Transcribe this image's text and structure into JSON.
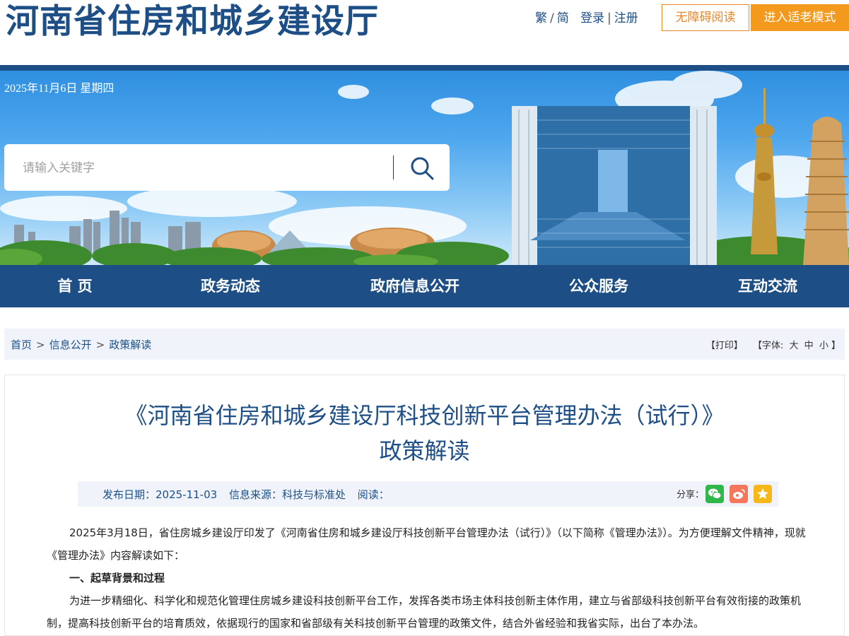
{
  "header": {
    "site_title": "河南省住房和城乡建设厅",
    "lang_trad": "繁",
    "lang_sep": "/",
    "lang_simp": "简",
    "login": "登录",
    "pipe": "|",
    "register": "注册",
    "accessible_btn": "无障碍阅读",
    "elder_btn": "进入适老模式"
  },
  "banner": {
    "date": "2025年11月6日 星期四",
    "search_placeholder": "请输入关键字"
  },
  "nav": {
    "items": [
      {
        "label": "首 页"
      },
      {
        "label": "政务动态"
      },
      {
        "label": "政府信息公开"
      },
      {
        "label": "公众服务"
      },
      {
        "label": "互动交流"
      }
    ]
  },
  "breadcrumb": {
    "items": [
      "首页",
      "信息公开",
      "政策解读"
    ],
    "sep": ">",
    "print": "【打印】",
    "font_label": "【字体:",
    "font_large": "大",
    "font_medium": "中",
    "font_small": "小",
    "font_close": "】"
  },
  "article": {
    "title_line1": "《河南省住房和城乡建设厅科技创新平台管理办法（试行）》",
    "title_line2": "政策解读",
    "publish_date": "发布日期：2025-11-03",
    "source": "信息来源：科技与标准处",
    "reads": "阅读：",
    "share_label": "分享：",
    "para1": "2025年3月18日，省住房城乡建设厅印发了《河南省住房和城乡建设厅科技创新平台管理办法（试行）》（以下简称《管理办法》）。为方便理解文件精神，现就《管理办法》内容解读如下：",
    "heading1": "一、起草背景和过程",
    "para2": "为进一步精细化、科学化和规范化管理住房城乡建设科技创新平台工作，发挥各类市场主体科技创新主体作用，建立与省部级科技创新平台有效衔接的政策机制，提高科技创新平台的培育质效，依据现行的国家和省部级有关科技创新平台管理的政策文件，结合外省经验和我省实际，出台了本办法。"
  },
  "colors": {
    "brand_blue": "#1d4f86",
    "accent_orange": "#f39a1e",
    "crumb_bg": "#f0f4fa"
  },
  "icons": [
    "search-icon",
    "wechat-icon",
    "weibo-icon",
    "favorite-icon"
  ]
}
